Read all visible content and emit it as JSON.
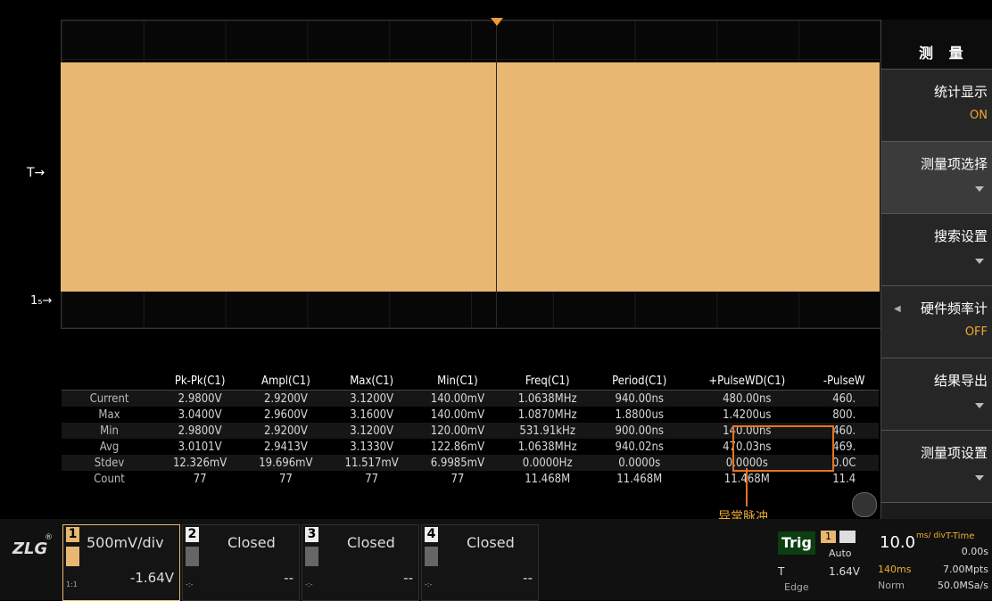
{
  "markers": {
    "trigger": "T→",
    "channel1": "1₅→"
  },
  "stats": {
    "headers": [
      "",
      "Pk-Pk(C1)",
      "Ampl(C1)",
      "Max(C1)",
      "Min(C1)",
      "Freq(C1)",
      "Period(C1)",
      "+PulseWD(C1)",
      "-PulseW"
    ],
    "rows": [
      [
        "Current",
        "2.9800V",
        "2.9200V",
        "3.1200V",
        "140.00mV",
        "1.0638MHz",
        "940.00ns",
        "480.00ns",
        "460."
      ],
      [
        "Max",
        "3.0400V",
        "2.9600V",
        "3.1600V",
        "140.00mV",
        "1.0870MHz",
        "1.8800us",
        "1.4200us",
        "800."
      ],
      [
        "Min",
        "2.9800V",
        "2.9200V",
        "3.1200V",
        "120.00mV",
        "531.91kHz",
        "900.00ns",
        "140.00ns",
        "460."
      ],
      [
        "Avg",
        "3.0101V",
        "2.9413V",
        "3.1330V",
        "122.86mV",
        "1.0638MHz",
        "940.02ns",
        "470.03ns",
        "469."
      ],
      [
        "Stdev",
        "12.326mV",
        "19.696mV",
        "11.517mV",
        "6.9985mV",
        "0.0000Hz",
        "0.0000s",
        "0.0000s",
        "0.0C"
      ],
      [
        "Count",
        "77",
        "77",
        "77",
        "77",
        "11.468M",
        "11.468M",
        "11.468M",
        "11.4"
      ]
    ]
  },
  "annotation": "异常脉冲",
  "menu": {
    "title": "测 量",
    "items": [
      {
        "label": "统计显示",
        "value": "ON"
      },
      {
        "label": "测量项选择",
        "value": ""
      },
      {
        "label": "搜索设置",
        "value": ""
      },
      {
        "label": "硬件频率计",
        "value": "OFF"
      },
      {
        "label": "结果导出",
        "value": ""
      },
      {
        "label": "测量项设置",
        "value": ""
      }
    ]
  },
  "channels": [
    {
      "num": "1",
      "scale": "500mV/div",
      "offset": "-1.64V",
      "side_label": "1:1"
    },
    {
      "num": "2",
      "scale": "Closed",
      "offset": "--",
      "side_label": "-:-"
    },
    {
      "num": "3",
      "scale": "Closed",
      "offset": "--",
      "side_label": "-:-"
    },
    {
      "num": "4",
      "scale": "Closed",
      "offset": "--",
      "side_label": "-:-"
    }
  ],
  "logo": "ZLG",
  "trigger": {
    "label": "Trig",
    "source": "1",
    "mode": "Auto",
    "t_label": "T",
    "level": "1.64V",
    "type": "Edge"
  },
  "timebase": {
    "scale": "10.0",
    "unit": "ms/ div",
    "label": "T-Time",
    "offset": "0.00s",
    "length": "140ms",
    "points": "7.00Mpts",
    "mode": "Norm",
    "rate": "50.0MSa/s"
  },
  "colors": {
    "channel1": "#e8b772",
    "highlight": "#e8731f",
    "accent": "#f0a830"
  }
}
